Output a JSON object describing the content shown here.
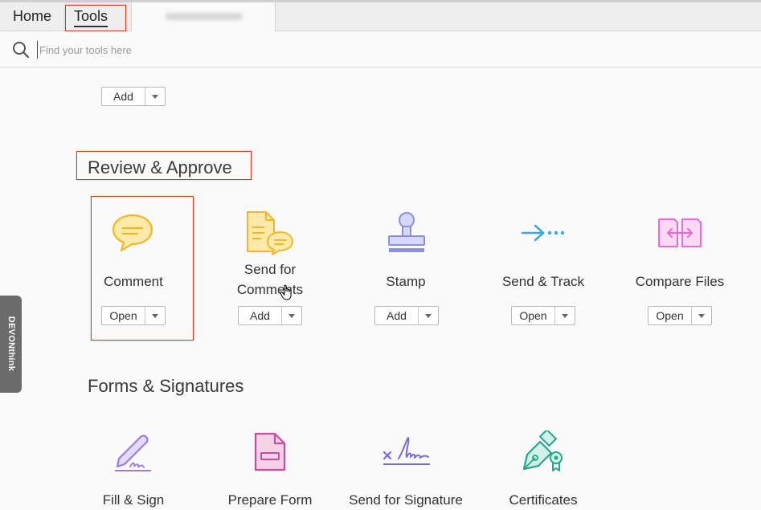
{
  "tabs": {
    "home": "Home",
    "tools": "Tools",
    "document": ""
  },
  "search": {
    "placeholder": "Find your tools here",
    "value": ""
  },
  "top_tool": {
    "button": "Add"
  },
  "review_section": {
    "title": "Review & Approve",
    "tools": [
      {
        "label": "Comment",
        "button": "Open",
        "icon": "comment-icon",
        "color": "#f5c542"
      },
      {
        "label_line1": "Send for",
        "label_line2": "Comments",
        "button": "Add",
        "icon": "send-for-comments-icon",
        "color": "#f5c542"
      },
      {
        "label": "Stamp",
        "button": "Add",
        "icon": "stamp-icon",
        "color": "#8a8fe0"
      },
      {
        "label": "Send & Track",
        "button": "Open",
        "icon": "send-track-icon",
        "color": "#3fa9d8"
      },
      {
        "label": "Compare Files",
        "button": "Open",
        "icon": "compare-files-icon",
        "color": "#e86ad6"
      }
    ]
  },
  "forms_section": {
    "title": "Forms & Signatures",
    "tools": [
      {
        "label": "Fill & Sign",
        "icon": "fill-sign-icon",
        "color": "#9b7ce6"
      },
      {
        "label": "Prepare Form",
        "icon": "prepare-form-icon",
        "color": "#c94ca0"
      },
      {
        "label": "Send for Signature",
        "icon": "send-for-signature-icon",
        "color": "#7b68d8"
      },
      {
        "label": "Certificates",
        "icon": "certificates-icon",
        "color": "#25a58a"
      }
    ]
  },
  "side_tab": "DEVONthink",
  "highlight_color": "#d7361e"
}
